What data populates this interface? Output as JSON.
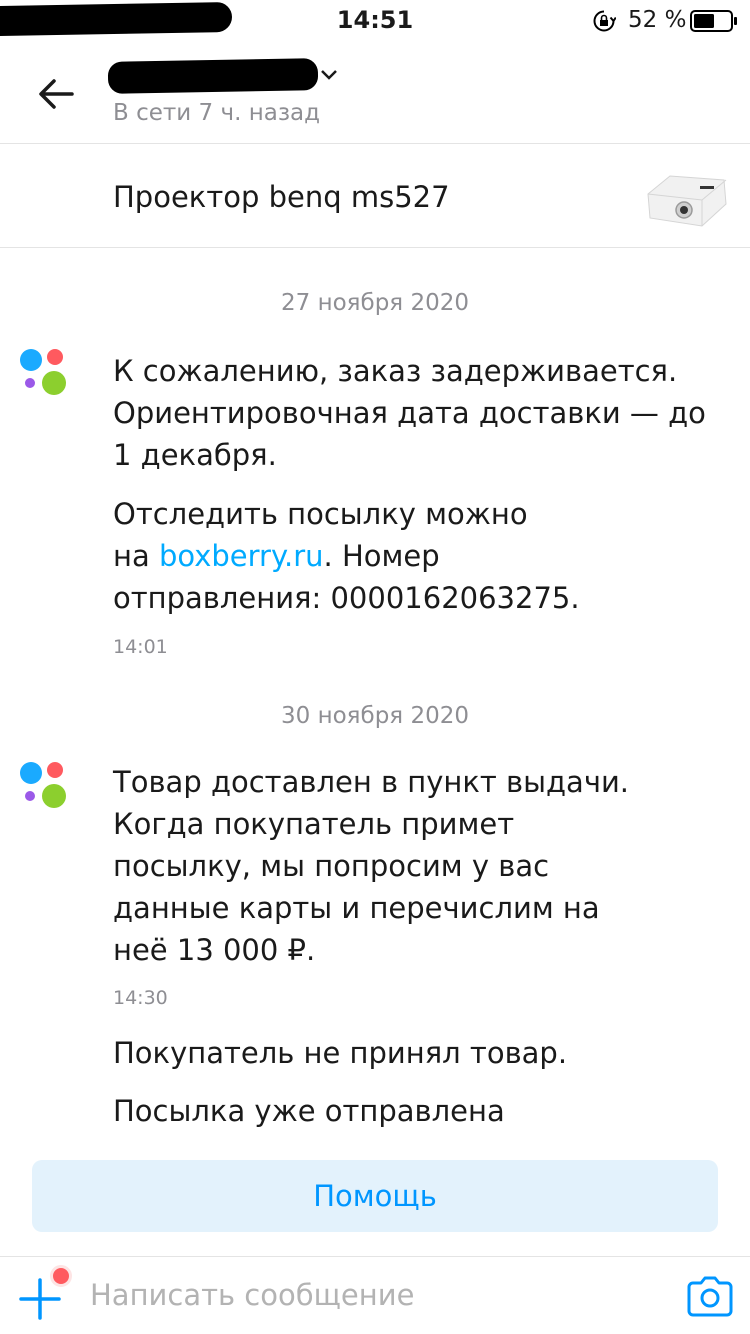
{
  "status_bar": {
    "time": "14:51",
    "battery": "52 %"
  },
  "header": {
    "presence": "В сети 7 ч. назад"
  },
  "product": {
    "title": "Проектор benq ms527"
  },
  "messages": [
    {
      "date": "27 ноября 2020",
      "paragraph1": "К сожалению, заказ задерживается. Ориентировочная дата доставки — до 1 декабря.",
      "p2_line1": "Отследить посылку можно",
      "p2_prefix": "на ",
      "p2_link": "boxberry.ru",
      "p2_suffix": ". Номер",
      "p2_line3": "отправления: 0000162063275.",
      "time": "14:01"
    },
    {
      "date": "30 ноября 2020",
      "paragraph1": "Товар доставлен в пункт выдачи. Когда покупатель примет посылку, мы попросим у вас данные карты и перечислим на неё 13 000 ₽.",
      "time": "14:30",
      "paragraph2": "Покупатель не принял товар.",
      "paragraph3": "Посылка уже отправлена"
    }
  ],
  "help_button": {
    "label": "Помощь"
  },
  "composer": {
    "placeholder": "Написать сообщение"
  },
  "colors": {
    "accent": "#00aaff",
    "help_bg": "#e3f2fc",
    "avatar_blue": "#1aaaff",
    "avatar_red": "#ff5a5f",
    "avatar_purple": "#9b59e8",
    "avatar_green": "#8ccf2e"
  }
}
